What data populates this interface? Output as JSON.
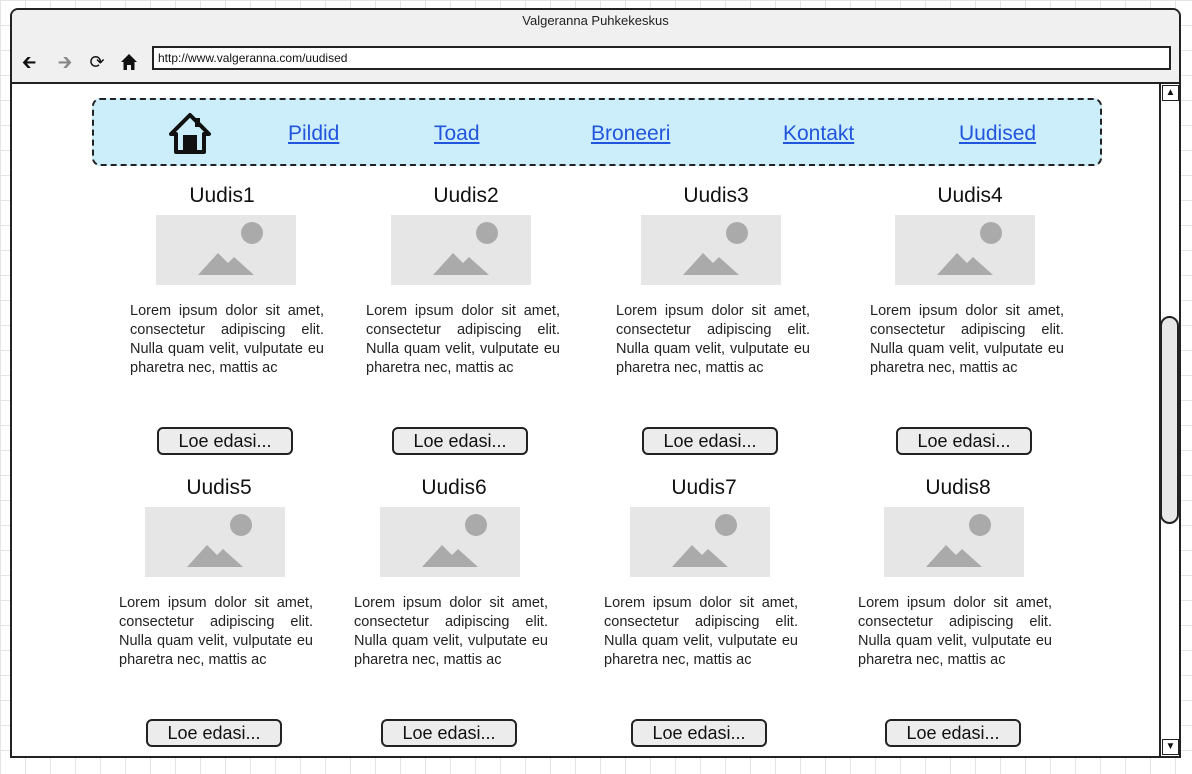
{
  "window": {
    "title": "Valgeranna Puhkekeskus",
    "address": "http://www.valgeranna.com/uudised"
  },
  "menu": {
    "items": [
      {
        "label": "Pildid"
      },
      {
        "label": "Toad"
      },
      {
        "label": "Broneeri"
      },
      {
        "label": "Kontakt"
      },
      {
        "label": "Uudised"
      }
    ]
  },
  "news": [
    {
      "title": "Uudis1",
      "text": "Lorem ipsum dolor sit amet, consectetur adipiscing elit. Nulla quam velit, vulputate eu pharetra nec, mattis ac",
      "button": "Loe edasi..."
    },
    {
      "title": "Uudis2",
      "text": "Lorem ipsum dolor sit amet, consectetur adipiscing elit. Nulla quam velit, vulputate eu pharetra nec, mattis ac",
      "button": "Loe edasi..."
    },
    {
      "title": "Uudis3",
      "text": "Lorem ipsum dolor sit amet, consectetur adipiscing elit. Nulla quam velit, vulputate eu pharetra nec, mattis ac",
      "button": "Loe edasi..."
    },
    {
      "title": "Uudis4",
      "text": "Lorem ipsum dolor sit amet, consectetur adipiscing elit. Nulla quam velit, vulputate eu pharetra nec, mattis ac",
      "button": "Loe edasi..."
    },
    {
      "title": "Uudis5",
      "text": "Lorem ipsum dolor sit amet, consectetur adipiscing elit. Nulla quam velit, vulputate eu pharetra nec, mattis ac",
      "button": "Loe edasi..."
    },
    {
      "title": "Uudis6",
      "text": "Lorem ipsum dolor sit amet, consectetur adipiscing elit. Nulla quam velit, vulputate eu pharetra nec, mattis ac",
      "button": "Loe edasi..."
    },
    {
      "title": "Uudis7",
      "text": "Lorem ipsum dolor sit amet, consectetur adipiscing elit. Nulla quam velit, vulputate eu pharetra nec, mattis ac",
      "button": "Loe edasi..."
    },
    {
      "title": "Uudis8",
      "text": "Lorem ipsum dolor sit amet, consectetur adipiscing elit. Nulla quam velit, vulputate eu pharetra nec, mattis ac",
      "button": "Loe edasi..."
    }
  ],
  "icons": {
    "back": "back-arrow-icon",
    "forward": "forward-arrow-icon",
    "reload": "reload-icon",
    "home": "home-icon",
    "image_placeholder": "image-placeholder-icon"
  },
  "colors": {
    "menu_background": "#cbeefa",
    "link": "#2255dd",
    "placeholder_bg": "#e6e6e6",
    "placeholder_fg": "#aaaaaa"
  }
}
